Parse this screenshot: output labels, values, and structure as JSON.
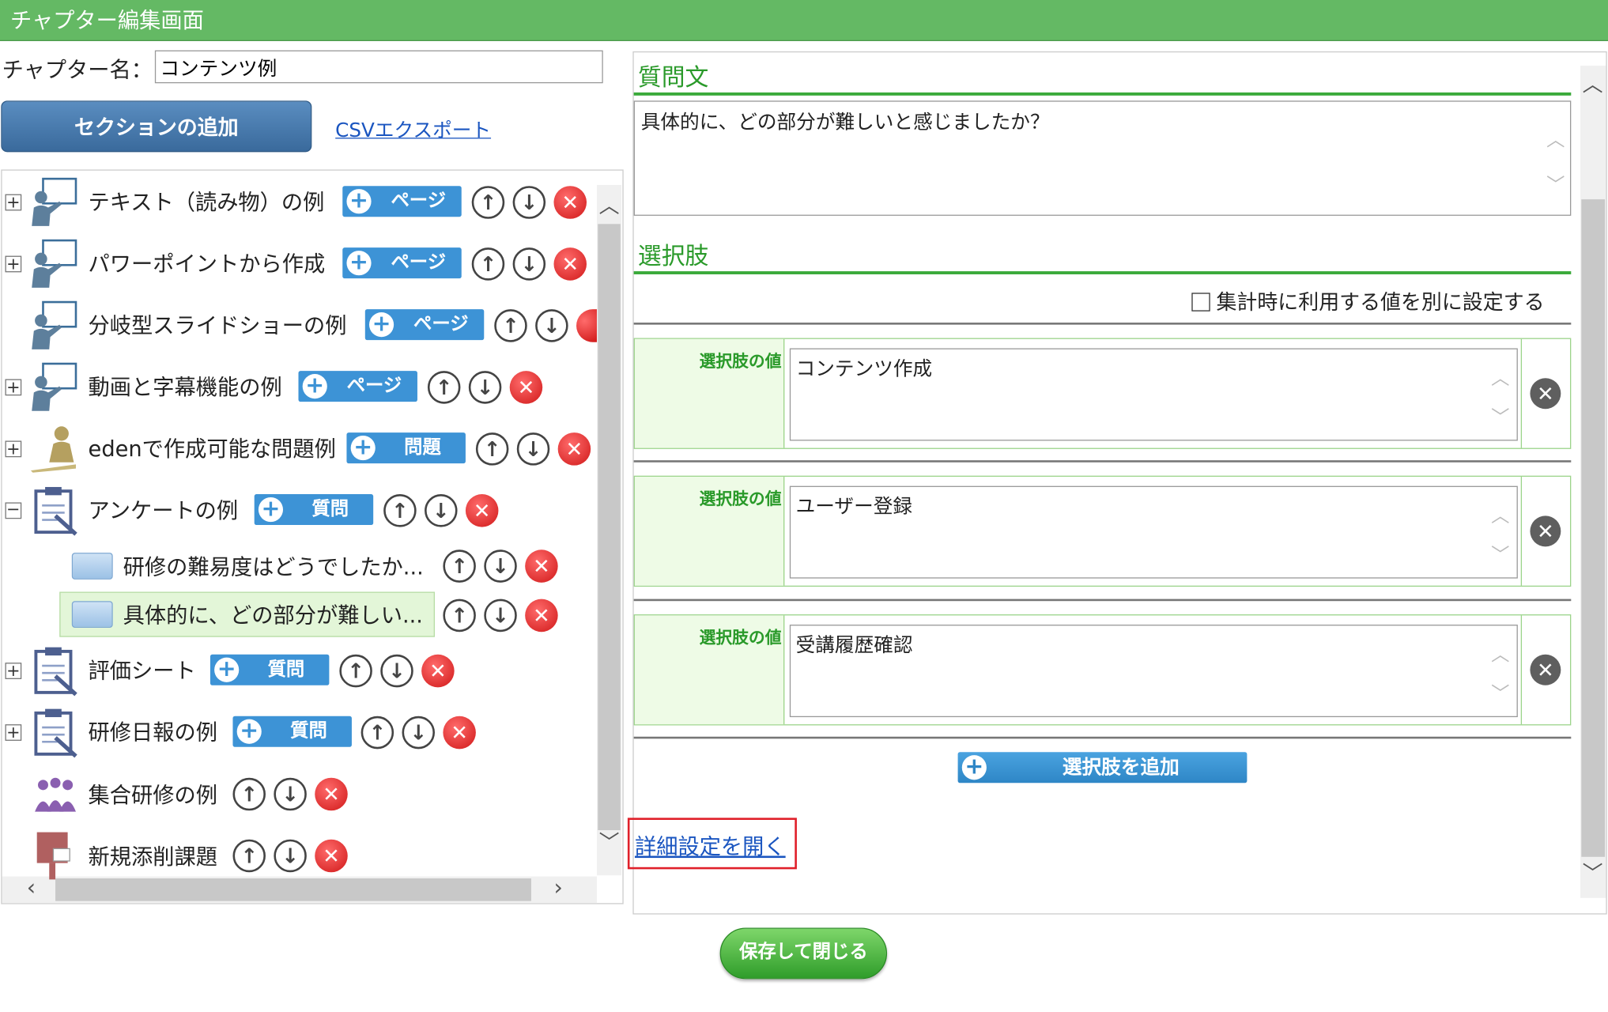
{
  "window": {
    "title": "チャプター編集画面"
  },
  "chapter": {
    "label": "チャプター名：",
    "value": "コンテンツ例"
  },
  "toolbar": {
    "add_section": "セクションの追加",
    "csv_export": "CSVエクスポート"
  },
  "tree": {
    "items": [
      {
        "label": "テキスト（読み物）の例",
        "kind": "ページ",
        "icon": "presentation-icon",
        "expander": "+"
      },
      {
        "label": "パワーポイントから作成",
        "kind": "ページ",
        "icon": "presentation-icon",
        "expander": "+"
      },
      {
        "label": "分岐型スライドショーの例",
        "kind": "ページ",
        "icon": "presentation-icon",
        "expander": ""
      },
      {
        "label": "動画と字幕機能の例",
        "kind": "ページ",
        "icon": "presentation-icon",
        "expander": "+"
      },
      {
        "label": "edenで作成可能な問題例",
        "kind": "問題",
        "icon": "test-taker-icon",
        "expander": "+"
      },
      {
        "label": "アンケートの例",
        "kind": "質問",
        "icon": "clipboard-icon",
        "expander": "−"
      },
      {
        "label": "評価シート",
        "kind": "質問",
        "icon": "clipboard-icon",
        "expander": "+"
      },
      {
        "label": "研修日報の例",
        "kind": "質問",
        "icon": "clipboard-icon",
        "expander": "+"
      },
      {
        "label": "集合研修の例",
        "kind": "",
        "icon": "group-icon",
        "expander": ""
      },
      {
        "label": "新規添削課題",
        "kind": "",
        "icon": "post-box-icon",
        "expander": ""
      }
    ],
    "subitems": [
      {
        "label": "研修の難易度はどうでしたか..."
      },
      {
        "label": "具体的に、どの部分が難しい..."
      }
    ]
  },
  "question": {
    "heading": "質問文",
    "text": "具体的に、どの部分が難しいと感じましたか？"
  },
  "choices": {
    "heading": "選択肢",
    "checkbox_label": "集計時に利用する値を別に設定する",
    "value_label": "選択肢の値",
    "items": [
      "コンテンツ作成",
      "ユーザー登録",
      "受講履歴確認"
    ],
    "add_label": "選択肢を追加"
  },
  "details_link": "詳細設定を開く",
  "save_button": "保存して閉じる",
  "colors": {
    "title_bar": "#64b964",
    "accent_green": "#2a9a2a",
    "button_blue": "#3d93d6",
    "delete_red": "#d01818"
  }
}
